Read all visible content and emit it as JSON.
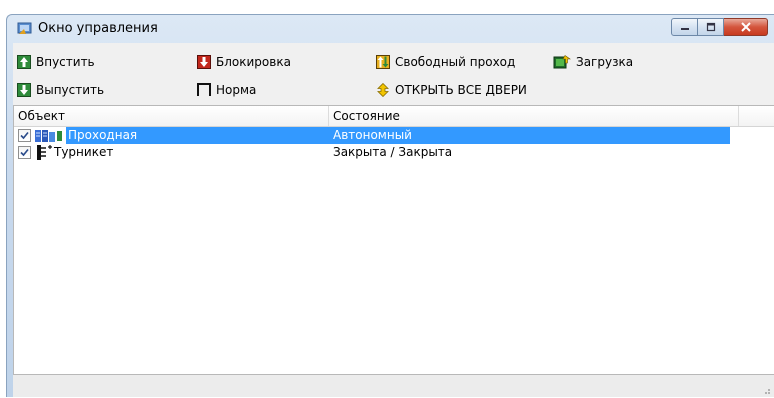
{
  "window": {
    "title": "Окно управления",
    "colors": {
      "title_bg": "#c9daee",
      "close_red": "#c73a1f",
      "selection": "#3399ff"
    }
  },
  "toolbar": {
    "buttons": [
      {
        "label": "Впустить",
        "icon": "arrow-up-icon"
      },
      {
        "label": "Выпустить",
        "icon": "arrow-down-icon"
      },
      {
        "label": "Блокировка",
        "icon": "lock-icon"
      },
      {
        "label": "Норма",
        "icon": "normal-icon"
      },
      {
        "label": "Свободный проход",
        "icon": "free-pass-icon"
      },
      {
        "label": "ОТКРЫТЬ ВСЕ ДВЕРИ",
        "icon": "open-all-doors-icon"
      },
      {
        "label": "Загрузка",
        "icon": "download-icon"
      }
    ]
  },
  "list": {
    "columns": [
      "Объект",
      "Состояние"
    ],
    "rows": [
      {
        "object": "Проходная",
        "state": "Автономный",
        "checked": true,
        "selected": true,
        "icon": "checkpoint-icon"
      },
      {
        "object": "Турникет",
        "state": "Закрыта / Закрыта",
        "checked": true,
        "selected": false,
        "icon": "turnstile-icon"
      }
    ]
  }
}
